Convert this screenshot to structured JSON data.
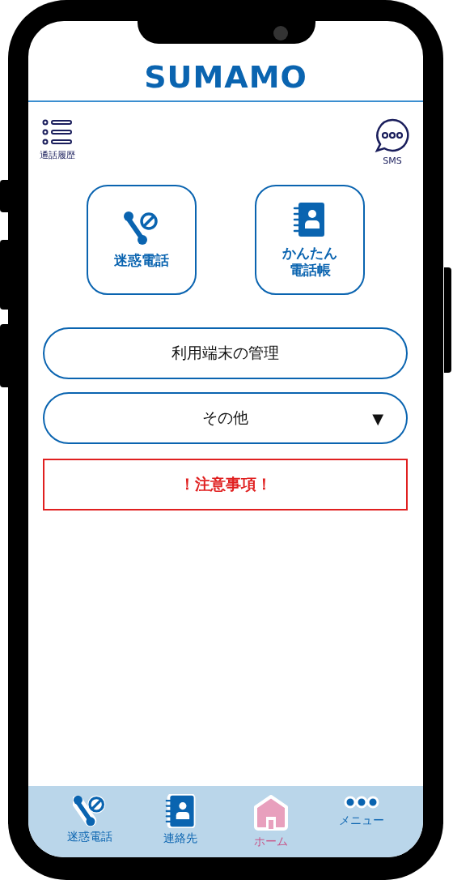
{
  "logo": "SUMAMO",
  "top_actions": [
    {
      "kind": "history",
      "label": "通話履歴"
    },
    {
      "kind": "sms",
      "label": "SMS"
    }
  ],
  "tiles": [
    {
      "kind": "block",
      "lines": [
        "迷惑電話"
      ]
    },
    {
      "kind": "book",
      "lines": [
        "かんたん",
        "電話帳"
      ]
    }
  ],
  "buttons": [
    {
      "kind": "plain",
      "label": "利用端末の管理"
    },
    {
      "kind": "dropdown",
      "label": "その他",
      "caret": "▼"
    },
    {
      "kind": "notice",
      "label": "！注意事項！"
    }
  ],
  "bottom_nav": [
    {
      "kind": "block",
      "label": "迷惑電話",
      "selected": false
    },
    {
      "kind": "book",
      "label": "連絡先",
      "selected": false
    },
    {
      "kind": "home",
      "label": "ホーム",
      "selected": true
    },
    {
      "kind": "dots",
      "label": "メニュー",
      "selected": false
    }
  ]
}
